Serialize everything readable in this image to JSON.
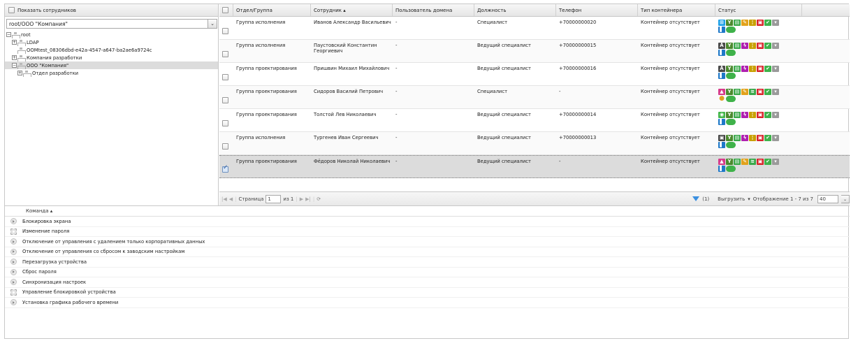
{
  "left": {
    "show_employees_label": "Показать сотрудников",
    "combo_value": "root/ООО \"Компания\"",
    "tree": [
      {
        "label": "root",
        "indent": 0,
        "toggle": "−",
        "selected": false
      },
      {
        "label": "LDAP",
        "indent": 1,
        "toggle": "+",
        "selected": false
      },
      {
        "label": "OOMtest_08306dbd-e42a-4547-a647-ba2ae6a9724c",
        "indent": 1,
        "toggle": "",
        "selected": false
      },
      {
        "label": "Компания разработки",
        "indent": 1,
        "toggle": "+",
        "selected": false
      },
      {
        "label": "ООО \"Компания\"",
        "indent": 1,
        "toggle": "−",
        "selected": true
      },
      {
        "label": "Отдел разработки",
        "indent": 2,
        "toggle": "+",
        "selected": false
      }
    ]
  },
  "grid": {
    "columns": [
      "Отдел/Группа",
      "Сотрудник ▴",
      "Пользователь домена",
      "Должность",
      "Телефон",
      "Тип контейнера",
      "Статус"
    ],
    "rows": [
      {
        "group": "Группа исполнения",
        "employee": "Иванов Александр Васильевич",
        "domain_user": "-",
        "position": "Специалист",
        "phone": "+70000000020",
        "container": "Контейнер отсутствует",
        "checked": false,
        "selected": false,
        "icons": [
          "win",
          "mdm",
          "lock",
          "key",
          "plug",
          "app",
          "ok",
          "gray",
          "id",
          "toggle"
        ]
      },
      {
        "group": "Группа исполнения",
        "employee": "Паустовский Константин Георгиевич",
        "domain_user": "-",
        "position": "Ведущий специалист",
        "phone": "+70000000015",
        "container": "Контейнер отсутствует",
        "checked": false,
        "selected": false,
        "icons": [
          "astra",
          "mdm",
          "lock",
          "bolt",
          "plug",
          "app",
          "ok",
          "gray",
          "id",
          "toggle"
        ]
      },
      {
        "group": "Группа проектирования",
        "employee": "Пришвин Михаил Михайлович",
        "domain_user": "-",
        "position": "Ведущий специалист",
        "phone": "+70000000016",
        "container": "Контейнер отсутствует",
        "checked": false,
        "selected": false,
        "icons": [
          "astra",
          "mdm",
          "lock",
          "bolt",
          "plug",
          "app",
          "ok",
          "gray",
          "id",
          "toggle"
        ]
      },
      {
        "group": "Группа проектирования",
        "employee": "Сидоров Василий Петрович",
        "domain_user": "-",
        "position": "Специалист",
        "phone": "-",
        "container": "Контейнер отсутствует",
        "checked": false,
        "selected": false,
        "icons": [
          "aurora",
          "mdm",
          "lock",
          "key",
          "wifi",
          "app",
          "ok",
          "gray",
          "user",
          "toggle"
        ]
      },
      {
        "group": "Группа проектирования",
        "employee": "Толстой Лев Николаевич",
        "domain_user": "-",
        "position": "Ведущий специалист",
        "phone": "+70000000014",
        "container": "Контейнер отсутствует",
        "checked": false,
        "selected": false,
        "icons": [
          "android",
          "mdm",
          "lock",
          "bolt",
          "plug",
          "app",
          "ok",
          "gray",
          "id",
          "toggle"
        ]
      },
      {
        "group": "Группа исполнения",
        "employee": "Тургенев Иван Сергеевич",
        "domain_user": "-",
        "position": "Ведущий специалист",
        "phone": "+70000000013",
        "container": "Контейнер отсутствует",
        "checked": false,
        "selected": false,
        "icons": [
          "apple",
          "mdm",
          "lock",
          "bolt",
          "plug",
          "app",
          "ok",
          "gray",
          "id",
          "toggle"
        ]
      },
      {
        "group": "Группа проектирования",
        "employee": "Фёдоров Николай Николаевич",
        "domain_user": "-",
        "position": "Ведущий специалист",
        "phone": "-",
        "container": "Контейнер отсутствует",
        "checked": true,
        "selected": true,
        "icons": [
          "aurora",
          "mdm",
          "lock",
          "key",
          "wifi",
          "app",
          "ok",
          "gray",
          "id",
          "toggle"
        ]
      }
    ]
  },
  "pager": {
    "page_label": "Страница",
    "page_value": "1",
    "of_label": "из 1",
    "filter_count": "(1)",
    "export_label": "Выгрузить",
    "display_label": "Отображение 1 - 7 из 7",
    "page_size": "40"
  },
  "commands": {
    "header": "Команда ▴",
    "items": [
      {
        "label": "Блокировка экрана",
        "icon": "play"
      },
      {
        "label": "Изменение пароля",
        "icon": "gear"
      },
      {
        "label": "Отключение от управления с удалением только корпоративных данных",
        "icon": "play"
      },
      {
        "label": "Отключение от управления со сбросом к заводским настройкам",
        "icon": "play"
      },
      {
        "label": "Перезагрузка устройства",
        "icon": "play"
      },
      {
        "label": "Сброс пароля",
        "icon": "play"
      },
      {
        "label": "Синхронизация настроек",
        "icon": "play"
      },
      {
        "label": "Управление блокировкой устройства",
        "icon": "gear"
      },
      {
        "label": "Установка графика рабочего времени",
        "icon": "play"
      }
    ]
  },
  "icon_colors": {
    "win": "#1ea1e8",
    "astra": "#4a4a4a",
    "aurora": "#d63a8a",
    "android": "#42b649",
    "apple": "#444444",
    "mdm": "#4b8a2e",
    "lock": "#3aa84a",
    "key": "#e2a21c",
    "bolt": "#b020b0",
    "plug": "#c8a000",
    "wifi": "#3aa84a",
    "app": "#d8222a",
    "ok": "#3fb24a",
    "gray": "#9a9a9a",
    "id": "#1e78c8",
    "user": "#e0a020",
    "toggle": "#3fb24a"
  }
}
